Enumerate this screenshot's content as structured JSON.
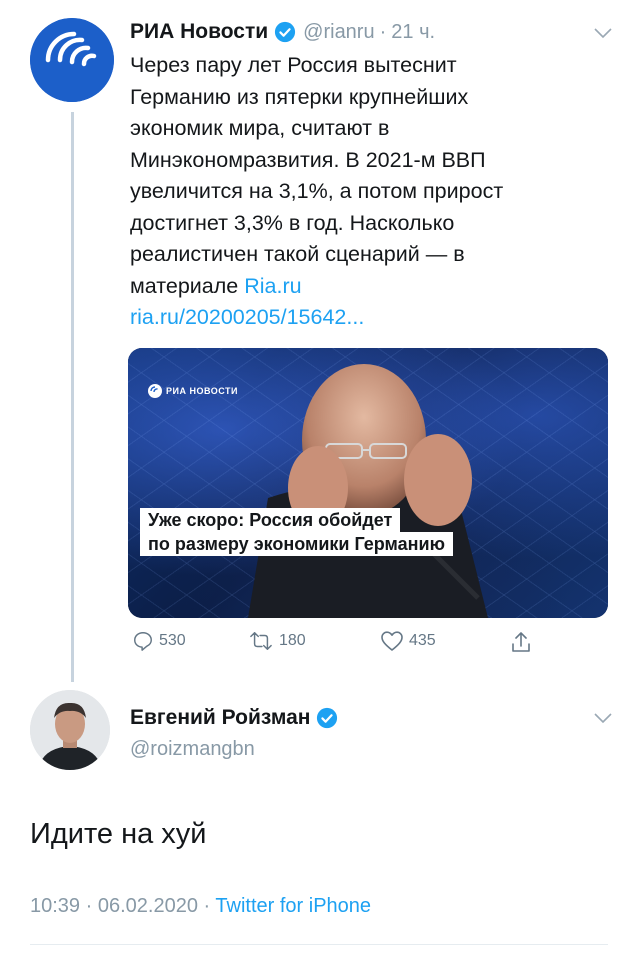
{
  "tweet": {
    "author_name": "РИА Новости",
    "handle": "@rianru",
    "time_sep": "·",
    "time_ago": "21 ч.",
    "text_lines": [
      "Через пару лет Россия вытеснит",
      "Германию из пятерки крупнейших",
      "экономик мира, считают в",
      "Минэкономразвития. В 2021-м ВВП",
      "увеличится на 3,1%, а потом прирост",
      "достигнет 3,3% в год. Насколько",
      "реалистичен такой сценарий — в"
    ],
    "text_prefix_last": "материале",
    "link_inline": "Ria.ru",
    "link_url": "ria.ru/20200205/15642...",
    "media": {
      "brand": "РИА НОВОСТИ",
      "caption_line1": "Уже скоро: Россия обойдет",
      "caption_line2": "по размеру экономики Германию"
    },
    "actions": {
      "replies": "530",
      "retweets": "180",
      "likes": "435"
    }
  },
  "reply": {
    "author_name": "Евгений Ройзман",
    "handle": "@roizmangbn",
    "text": "Идите на хуй",
    "time": "10:39",
    "date": "06.02.2020",
    "sep": "·",
    "client": "Twitter for iPhone"
  },
  "colors": {
    "accent": "#1da1f2",
    "verified": "#1da1f2",
    "muted": "#8899a6",
    "ria_blue": "#1c5fc9"
  },
  "icons": [
    "ria-logo-icon",
    "verified-icon",
    "chevron-down-icon",
    "reply-icon",
    "retweet-icon",
    "like-icon",
    "share-icon"
  ]
}
